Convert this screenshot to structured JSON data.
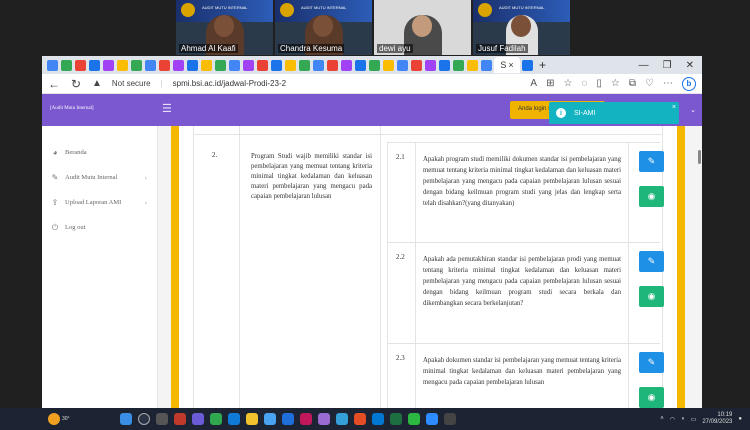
{
  "call": {
    "participants": [
      {
        "name": "Ahmad Al Kaafi"
      },
      {
        "name": "Chandra Kesuma"
      },
      {
        "name": "dewi ayu"
      },
      {
        "name": "Jusuf Fadilah"
      }
    ],
    "banner_text": "AUDIT MUTU INTERNAL"
  },
  "browser": {
    "security_label": "Not secure",
    "url": "spmi.bsi.ac.id/jadwal-Prodi-23-2",
    "active_tab_label": "S",
    "profile_initial": "b",
    "icons": {
      "back": "arrow-left-icon",
      "reload": "reload-icon",
      "warning": "warning-icon"
    }
  },
  "app": {
    "brand": "[Audit Mutu Internal]",
    "notice": "Anda login sebagai ...",
    "sidebar": {
      "items": [
        {
          "label": "Beranda",
          "icon": "dashboard-icon"
        },
        {
          "label": "Audit Mutu Internal",
          "icon": "edit-icon",
          "has_chevron": true
        },
        {
          "label": "Upload Laporan AMI",
          "icon": "upload-icon",
          "has_chevron": true
        },
        {
          "label": "Log out",
          "icon": "logout-icon"
        }
      ]
    },
    "main_item": {
      "number": "2.",
      "text": "Program Studi wajib memiliki standar isi pembelajaran yang memuat tentang kriteria minimal tingkat kedalaman dan keluasan materi pembelajaran yang mengacu pada capaian pembelajaran lulusan"
    },
    "questions": [
      {
        "number": "2.1",
        "text": "Apakah program studi memiliki dokumen standar isi pembelajaran yang memuat tentang kriteria minimal tingkat kedalaman dan keluasan materi pembelajaran yang mengacu pada capaian pembelajaran lulusan sesuai dengan bidang keilmuan program studi yang jelas dan lengkap serta telah disahkan?(yang ditanyakan)"
      },
      {
        "number": "2.2",
        "text": "Apakah ada pemutakhiran standar isi pembelajaran prodi yang memuat tentang kriteria minimal tingkat kedalaman dan keluasan materi pembelajaran yang mengacu pada capaian pembelajaran lulusan sesuai dengan bidang keilmuan program studi secara berkala dan dikembangkan secara berkelanjutan?"
      },
      {
        "number": "2.3",
        "text": "Apakah dokumen standar isi pembelajaran yang memuat tentang kriteria minimal tingkat kedalaman dan keluasan materi pembelajaran yang mengacu pada capaian pembelajaran lulusan"
      }
    ],
    "toast": {
      "title": "SI-AMI",
      "icon": "info-icon"
    }
  },
  "taskbar": {
    "weather": "30°",
    "time": "10:19",
    "date": "27/09/2023"
  }
}
